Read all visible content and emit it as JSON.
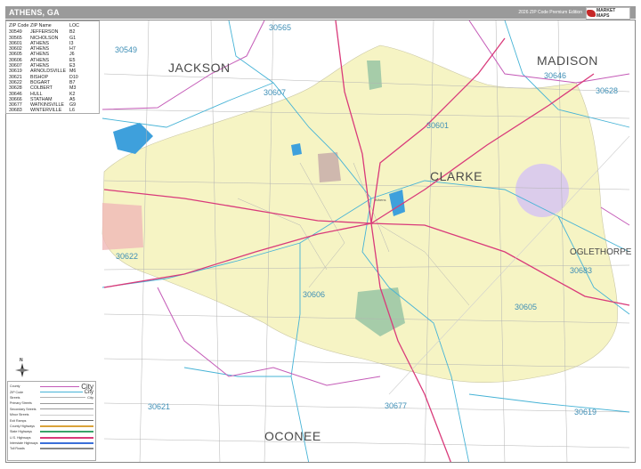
{
  "title": "ATHENS, GA",
  "edition": "2026 ZIP Code Premium Edition",
  "logo_text": "MARKET MAPS",
  "zip_table": {
    "headers": [
      "ZIP Code",
      "ZIP Name",
      "LOC"
    ],
    "rows": [
      [
        "30549",
        "JEFFERSON",
        "B2"
      ],
      [
        "30565",
        "NICHOLSON",
        "G1"
      ],
      [
        "30601",
        "ATHENS",
        "I3"
      ],
      [
        "30602",
        "ATHENS",
        "H7"
      ],
      [
        "30605",
        "ATHENS",
        "J6"
      ],
      [
        "30606",
        "ATHENS",
        "E5"
      ],
      [
        "30607",
        "ATHENS",
        "E3"
      ],
      [
        "30619",
        "ARNOLDSVILLE",
        "M6"
      ],
      [
        "30621",
        "BISHOP",
        "D10"
      ],
      [
        "30622",
        "BOGART",
        "B7"
      ],
      [
        "30628",
        "COLBERT",
        "M3"
      ],
      [
        "30646",
        "HULL",
        "K2"
      ],
      [
        "30666",
        "STATHAM",
        "A5"
      ],
      [
        "30677",
        "WATKINSVILLE",
        "G9"
      ],
      [
        "30683",
        "WINTERVILLE",
        "L6"
      ]
    ]
  },
  "counties": [
    "JACKSON",
    "MADISON",
    "CLARKE",
    "OGLETHORPE",
    "OCONEE"
  ],
  "zip_labels": [
    "30565",
    "30549",
    "30646",
    "30628",
    "30607",
    "30601",
    "30683",
    "30622",
    "30606",
    "30605",
    "30621",
    "30677",
    "30619"
  ],
  "place_labels": [
    "Athens"
  ],
  "legend": {
    "rows": [
      "County",
      "ZIP Code",
      "Streets",
      "Primary Streets",
      "Secondary Streets",
      "Minor Streets",
      "Exit Ramps",
      "County Highways",
      "State Highways",
      "U.S. Highways",
      "Interstate Highways",
      "Toll Roads"
    ],
    "city_samples": [
      "City",
      "City",
      "City"
    ]
  },
  "compass": "N",
  "colors": {
    "background": "#ffffff",
    "city_area": "#f6f4c4",
    "zip_boundary": "#46b3d6",
    "county_boundary": "#c45ab7",
    "highway": "#d93a7a",
    "water": "#3ea0dc",
    "park": "#9dc8a6",
    "pink_area": "#f0b8b8",
    "lavender_area": "#d8c8f0",
    "title_bar": "#9a9a9a",
    "zip_label": "#3f8fb6"
  }
}
